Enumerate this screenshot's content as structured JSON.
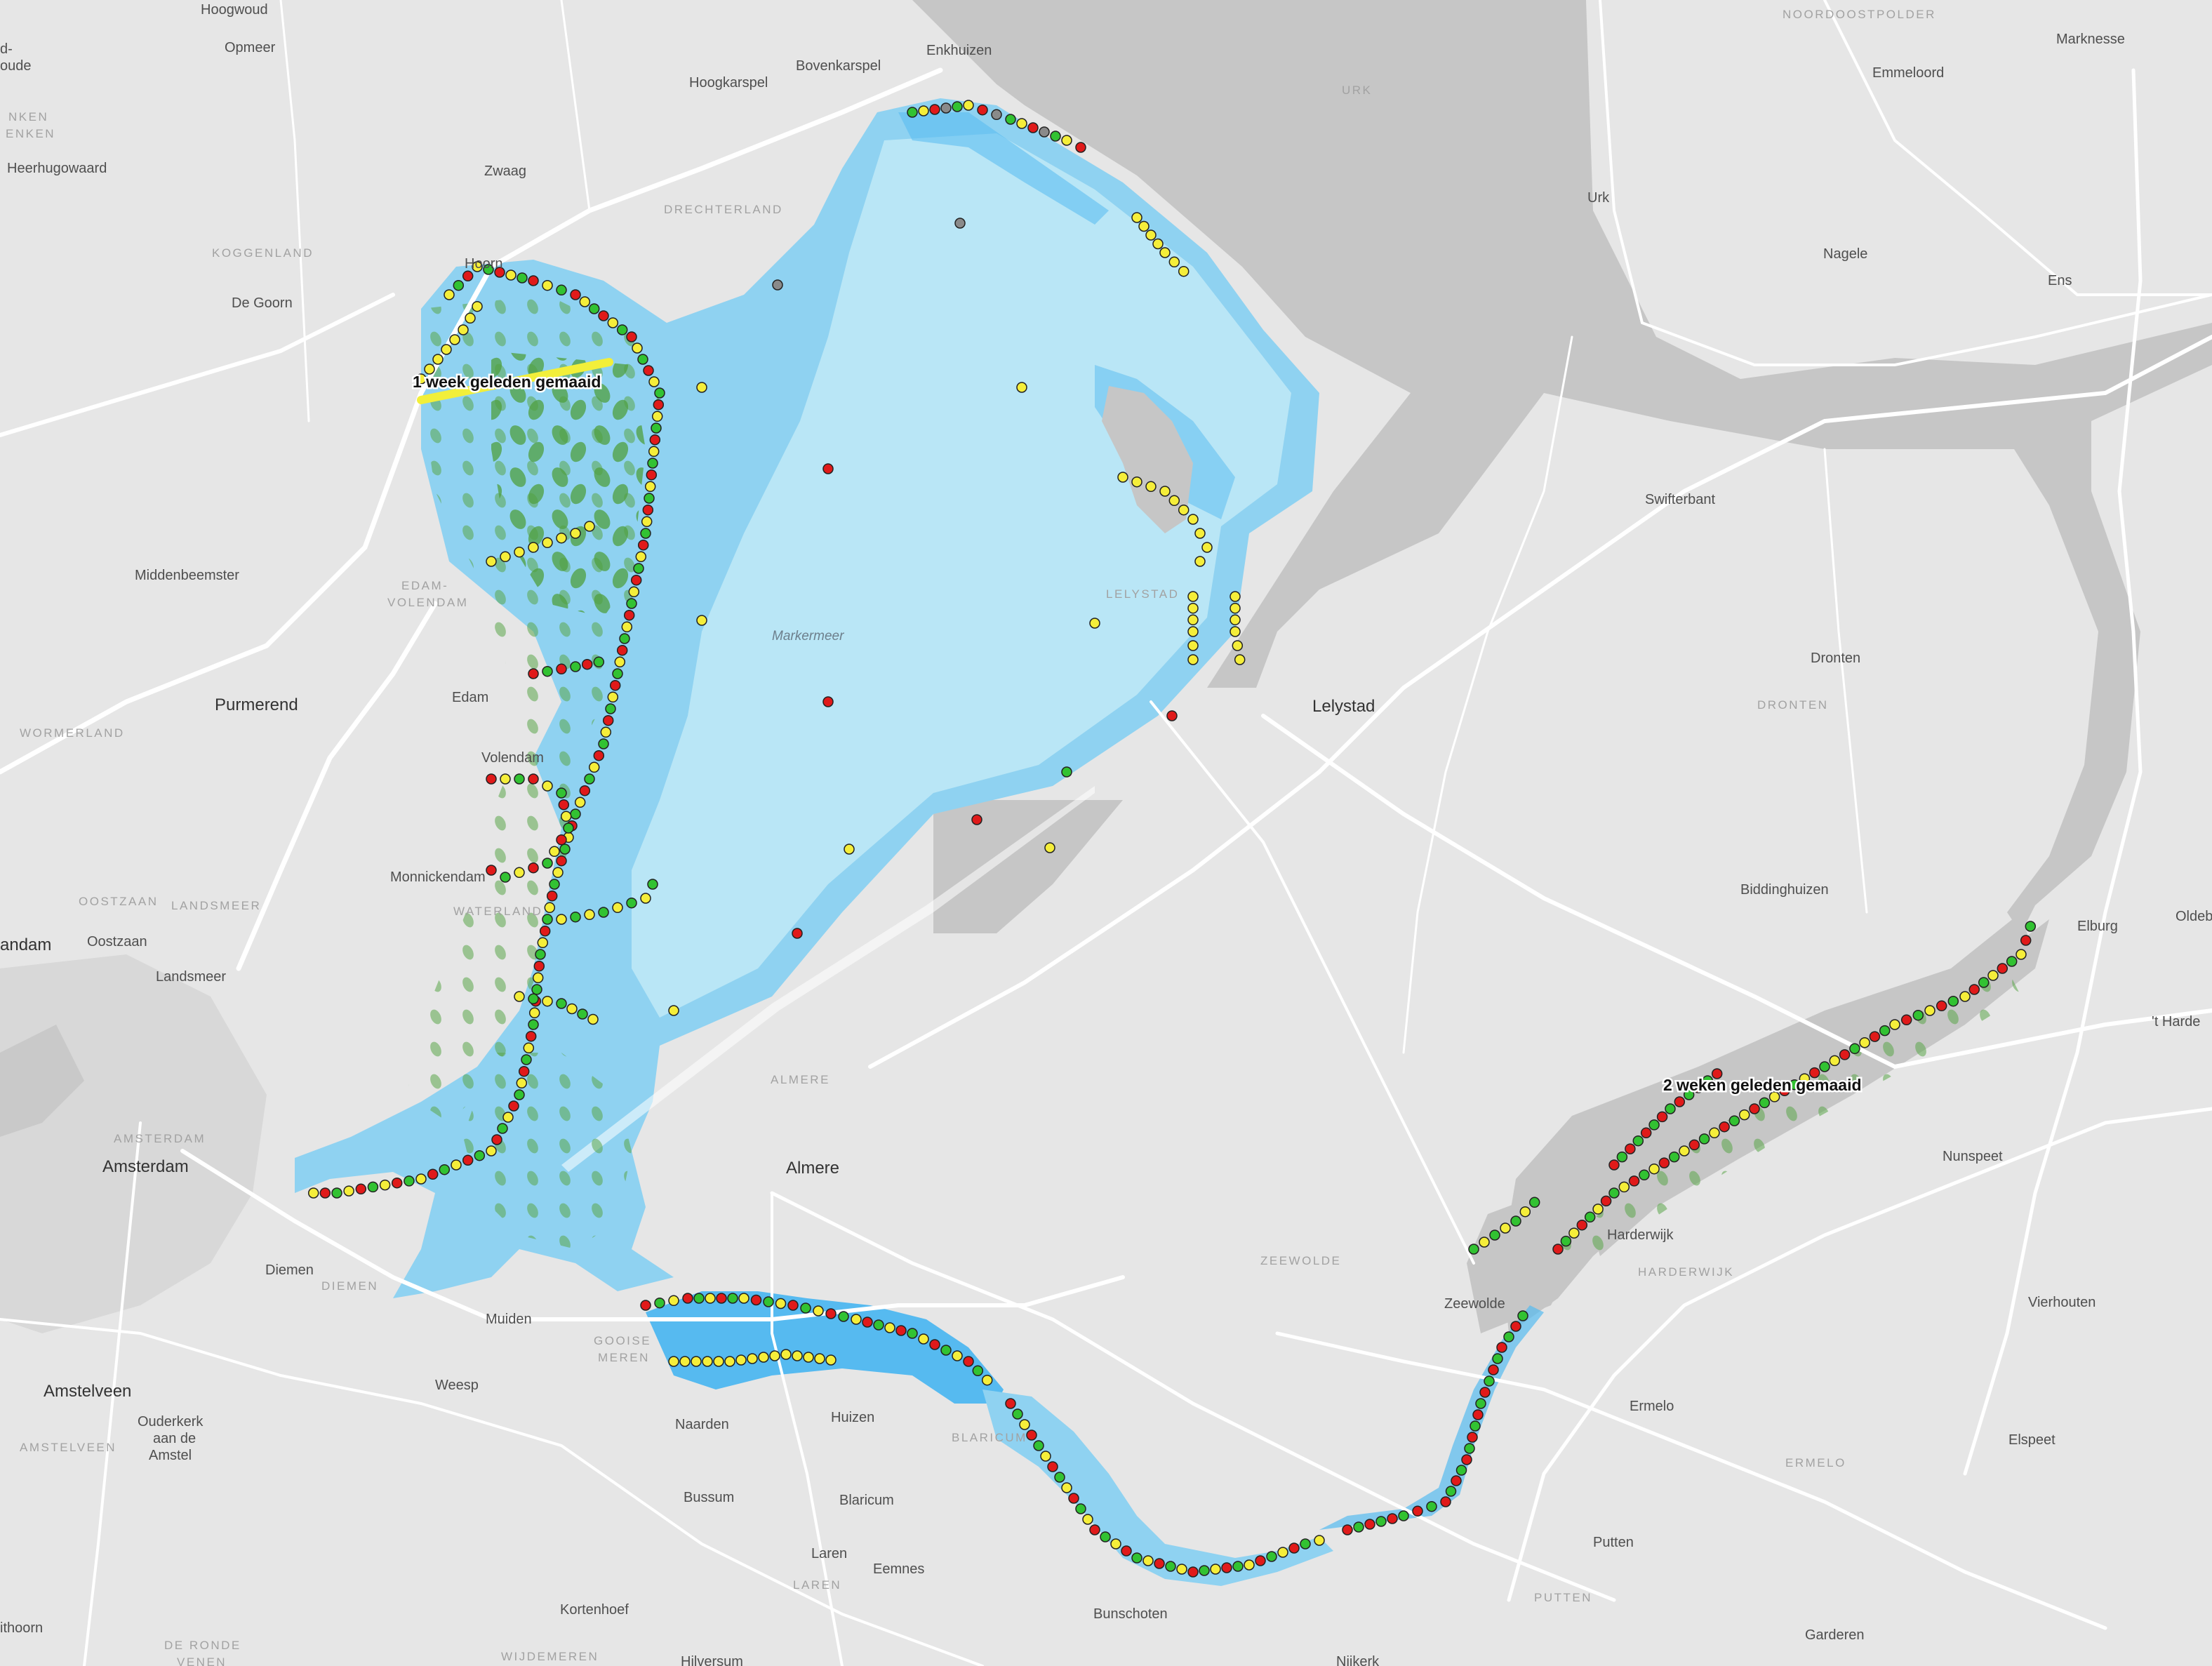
{
  "colors": {
    "land": "#e6e6e6",
    "polder_dark": "#c6c6c6",
    "lake": "#b9e6f6",
    "lake_mid": "#8fd2f1",
    "lake_deep": "#56baf0",
    "road": "#ffffff",
    "dot_red": "#e01a1a",
    "dot_green": "#32c232",
    "dot_yellow": "#f5ee3a",
    "dot_gray": "#8a8a8a",
    "vegetation": "#5aa64a",
    "mowed_line": "#f2ef3a"
  },
  "map": {
    "water_label": "Markermeer",
    "places": [
      {
        "name": "Hoogwoud",
        "kind": "town"
      },
      {
        "name": "Opmeer",
        "kind": "town"
      },
      {
        "name": "Enkhuizen",
        "kind": "town"
      },
      {
        "name": "Bovenkarspel",
        "kind": "town"
      },
      {
        "name": "Hoogkarspel",
        "kind": "town"
      },
      {
        "name": "Heerhugowaard",
        "kind": "town"
      },
      {
        "name": "Zwaag",
        "kind": "town"
      },
      {
        "name": "Hoorn",
        "kind": "town"
      },
      {
        "name": "De Goorn",
        "kind": "town"
      },
      {
        "name": "Middenbeemster",
        "kind": "town"
      },
      {
        "name": "Purmerend",
        "kind": "city"
      },
      {
        "name": "Edam",
        "kind": "town"
      },
      {
        "name": "Volendam",
        "kind": "town"
      },
      {
        "name": "Monnickendam",
        "kind": "town"
      },
      {
        "name": "Oostzaan",
        "kind": "town"
      },
      {
        "name": "Landsmeer",
        "kind": "town"
      },
      {
        "name": "Amsterdam",
        "kind": "city"
      },
      {
        "name": "Diemen",
        "kind": "town"
      },
      {
        "name": "Muiden",
        "kind": "town"
      },
      {
        "name": "Weesp",
        "kind": "town"
      },
      {
        "name": "Amstelveen",
        "kind": "city"
      },
      {
        "name": "Ouderkerk",
        "kind": "town"
      },
      {
        "name": "aan de",
        "kind": "town"
      },
      {
        "name": "Amstel",
        "kind": "town"
      },
      {
        "name": "Naarden",
        "kind": "town"
      },
      {
        "name": "Bussum",
        "kind": "town"
      },
      {
        "name": "Huizen",
        "kind": "town"
      },
      {
        "name": "Blaricum",
        "kind": "town"
      },
      {
        "name": "Laren",
        "kind": "town"
      },
      {
        "name": "Eemnes",
        "kind": "town"
      },
      {
        "name": "Kortenhoef",
        "kind": "town"
      },
      {
        "name": "Hilversum",
        "kind": "town"
      },
      {
        "name": "Bunschoten",
        "kind": "town"
      },
      {
        "name": "Almere",
        "kind": "city"
      },
      {
        "name": "Lelystad",
        "kind": "city"
      },
      {
        "name": "Urk",
        "kind": "town"
      },
      {
        "name": "Emmeloord",
        "kind": "town"
      },
      {
        "name": "Marknesse",
        "kind": "town"
      },
      {
        "name": "Nagele",
        "kind": "town"
      },
      {
        "name": "Ens",
        "kind": "town"
      },
      {
        "name": "Swifterbant",
        "kind": "town"
      },
      {
        "name": "Dronten",
        "kind": "town"
      },
      {
        "name": "Biddinghuizen",
        "kind": "town"
      },
      {
        "name": "Elburg",
        "kind": "town"
      },
      {
        "name": "Oldeb",
        "kind": "town"
      },
      {
        "name": "'t Harde",
        "kind": "town"
      },
      {
        "name": "Nunspeet",
        "kind": "town"
      },
      {
        "name": "Harderwijk",
        "kind": "town"
      },
      {
        "name": "Zeewolde",
        "kind": "town"
      },
      {
        "name": "Vierhouten",
        "kind": "town"
      },
      {
        "name": "Ermelo",
        "kind": "town"
      },
      {
        "name": "Elspeet",
        "kind": "town"
      },
      {
        "name": "Putten",
        "kind": "town"
      },
      {
        "name": "Garderen",
        "kind": "town"
      },
      {
        "name": "Nijkerk",
        "kind": "town"
      },
      {
        "name": "andam",
        "kind": "city"
      },
      {
        "name": "d-",
        "kind": "town"
      },
      {
        "name": "oude",
        "kind": "town"
      },
      {
        "name": "ithoorn",
        "kind": "town"
      }
    ],
    "regions": [
      "KOGGENLAND",
      "DRECHTERLAND",
      "EDAM-",
      "VOLENDAM",
      "WORMERLAND",
      "OOSTZAAN",
      "LANDSMEER",
      "WATERLAND",
      "AMSTERDAM",
      "DIEMEN",
      "AMSTELVEEN",
      "GOOISE",
      "MEREN",
      "LAREN",
      "DE RONDE",
      "VENEN",
      "WIJDEMEREN",
      "ALMERE",
      "LELYSTAD",
      "URK",
      "NOORDOOSTPOLDER",
      "DRONTEN",
      "ZEEWOLDE",
      "HARDERWIJK",
      "ERMELO",
      "PUTTEN",
      "BLARICUM",
      "NKEN",
      "ENKEN"
    ],
    "annotations": [
      {
        "text": "1 week geleden gemaaid"
      },
      {
        "text": "2 weken geleden gemaaid"
      }
    ]
  }
}
